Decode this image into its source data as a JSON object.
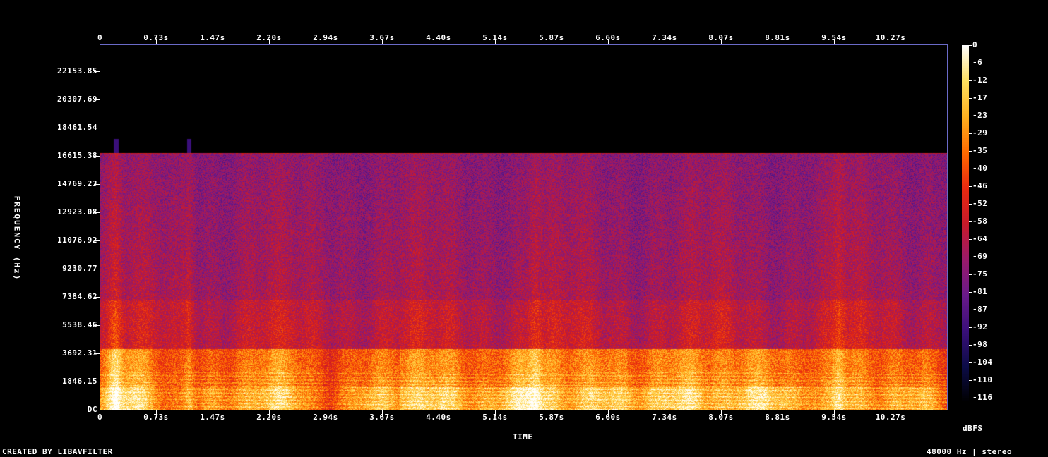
{
  "chart_data": {
    "type": "heatmap",
    "title": "",
    "xlabel": "TIME",
    "ylabel": "FREQUENCY (Hz)",
    "x_ticks": [
      "0",
      "0.73s",
      "1.47s",
      "2.20s",
      "2.94s",
      "3.67s",
      "4.40s",
      "5.14s",
      "5.87s",
      "6.60s",
      "7.34s",
      "8.07s",
      "8.81s",
      "9.54s",
      "10.27s"
    ],
    "y_ticks": [
      "DC",
      "1846.15",
      "3692.31",
      "5538.46",
      "7384.62",
      "9230.77",
      "11076.92",
      "12923.08",
      "14769.23",
      "16615.38",
      "18461.54",
      "20307.69",
      "22153.85"
    ],
    "xlim": [
      0,
      11.0
    ],
    "ylim": [
      0,
      24000
    ],
    "colorbar_label": "dBFS",
    "colorbar_ticks": [
      "0",
      "-6",
      "-12",
      "-17",
      "-23",
      "-29",
      "-35",
      "-40",
      "-46",
      "-52",
      "-58",
      "-64",
      "-69",
      "-75",
      "-81",
      "-87",
      "-92",
      "-98",
      "-104",
      "-110",
      "-116"
    ],
    "colorbar_range": [
      -120,
      0
    ],
    "colormap": [
      "#000000",
      "#0c0c48",
      "#3a0f7a",
      "#6a1a8a",
      "#9a1a6a",
      "#c81a2a",
      "#e82a10",
      "#ff6a00",
      "#ffb020",
      "#ffe060",
      "#ffffff"
    ],
    "content_cutoff_hz": 16900,
    "loud_events_s": [
      0.2,
      1.15,
      5.65,
      9.6
    ]
  },
  "footer": {
    "left": "CREATED BY LIBAVFILTER",
    "right": "48000 Hz | stereo"
  }
}
